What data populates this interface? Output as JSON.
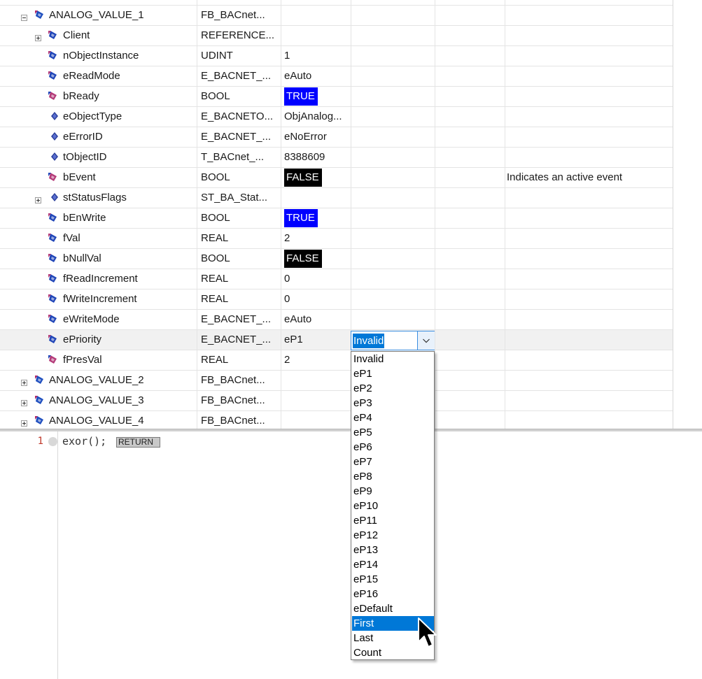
{
  "watch_table": {
    "rows": [
      {
        "name": "ANALOG_VALUE_1",
        "type": "FB_BACnet...",
        "value": "",
        "comment": "",
        "indent": 0,
        "expander": "minus",
        "icon": "fb-instance-icon"
      },
      {
        "name": "Client",
        "type": "REFERENCE...",
        "value": "",
        "comment": "",
        "indent": 1,
        "expander": "plus",
        "icon": "input-var-icon"
      },
      {
        "name": "nObjectInstance",
        "type": "UDINT",
        "value": "1",
        "comment": "",
        "indent": 1,
        "expander": "",
        "icon": "input-var-icon"
      },
      {
        "name": "eReadMode",
        "type": "E_BACNET_...",
        "value": "eAuto",
        "comment": "",
        "indent": 1,
        "expander": "",
        "icon": "input-var-icon"
      },
      {
        "name": "bReady",
        "type": "BOOL",
        "value": "TRUE",
        "value_style": "true",
        "comment": "",
        "indent": 1,
        "expander": "",
        "icon": "output-var-icon"
      },
      {
        "name": "eObjectType",
        "type": "E_BACNETO...",
        "value": "ObjAnalog...",
        "comment": "",
        "indent": 1,
        "expander": "",
        "icon": "local-var-icon"
      },
      {
        "name": "eErrorID",
        "type": "E_BACNET_...",
        "value": "eNoError",
        "comment": "",
        "indent": 1,
        "expander": "",
        "icon": "local-var-icon"
      },
      {
        "name": "tObjectID",
        "type": "T_BACnet_...",
        "value": "8388609",
        "comment": "",
        "indent": 1,
        "expander": "",
        "icon": "local-var-icon"
      },
      {
        "name": "bEvent",
        "type": "BOOL",
        "value": "FALSE",
        "value_style": "false",
        "comment": "Indicates an active event",
        "indent": 1,
        "expander": "",
        "icon": "output-var-icon"
      },
      {
        "name": "stStatusFlags",
        "type": "ST_BA_Stat...",
        "value": "",
        "comment": "",
        "indent": 1,
        "expander": "plus",
        "icon": "local-var-icon"
      },
      {
        "name": "bEnWrite",
        "type": "BOOL",
        "value": "TRUE",
        "value_style": "true",
        "comment": "",
        "indent": 1,
        "expander": "",
        "icon": "input-var-icon"
      },
      {
        "name": "fVal",
        "type": "REAL",
        "value": "2",
        "comment": "",
        "indent": 1,
        "expander": "",
        "icon": "input-var-icon"
      },
      {
        "name": "bNullVal",
        "type": "BOOL",
        "value": "FALSE",
        "value_style": "false",
        "comment": "",
        "indent": 1,
        "expander": "",
        "icon": "input-var-icon"
      },
      {
        "name": "fReadIncrement",
        "type": "REAL",
        "value": "0",
        "comment": "",
        "indent": 1,
        "expander": "",
        "icon": "input-var-icon"
      },
      {
        "name": "fWriteIncrement",
        "type": "REAL",
        "value": "0",
        "comment": "",
        "indent": 1,
        "expander": "",
        "icon": "input-var-icon"
      },
      {
        "name": "eWriteMode",
        "type": "E_BACNET_...",
        "value": "eAuto",
        "comment": "",
        "indent": 1,
        "expander": "",
        "icon": "input-var-icon"
      },
      {
        "name": "ePriority",
        "type": "E_BACNET_...",
        "value": "eP1",
        "comment": "",
        "indent": 1,
        "expander": "",
        "icon": "input-var-icon",
        "selected": true
      },
      {
        "name": "fPresVal",
        "type": "REAL",
        "value": "2",
        "comment": "",
        "indent": 1,
        "expander": "",
        "icon": "output-var-icon"
      },
      {
        "name": "ANALOG_VALUE_2",
        "type": "FB_BACnet...",
        "value": "",
        "comment": "",
        "indent": 0,
        "expander": "plus",
        "icon": "fb-instance-icon"
      },
      {
        "name": "ANALOG_VALUE_3",
        "type": "FB_BACnet...",
        "value": "",
        "comment": "",
        "indent": 0,
        "expander": "plus",
        "icon": "fb-instance-icon"
      },
      {
        "name": "ANALOG_VALUE_4",
        "type": "FB_BACnet...",
        "value": "",
        "comment": "",
        "indent": 0,
        "expander": "plus",
        "icon": "fb-instance-icon"
      }
    ]
  },
  "prepared_value": {
    "current": "Invalid",
    "options": [
      "Invalid",
      "eP1",
      "eP2",
      "eP3",
      "eP4",
      "eP5",
      "eP6",
      "eP7",
      "eP8",
      "eP9",
      "eP10",
      "eP11",
      "eP12",
      "eP13",
      "eP14",
      "eP15",
      "eP16",
      "eDefault",
      "First",
      "Last",
      "Count"
    ],
    "highlighted": "First"
  },
  "editor": {
    "line_number": "1",
    "code": "exor();",
    "return_label": "RETURN"
  },
  "colors": {
    "true_badge": "#0000ff",
    "false_badge": "#000000",
    "selection": "#0078d7",
    "line_number": "#c0392b"
  }
}
